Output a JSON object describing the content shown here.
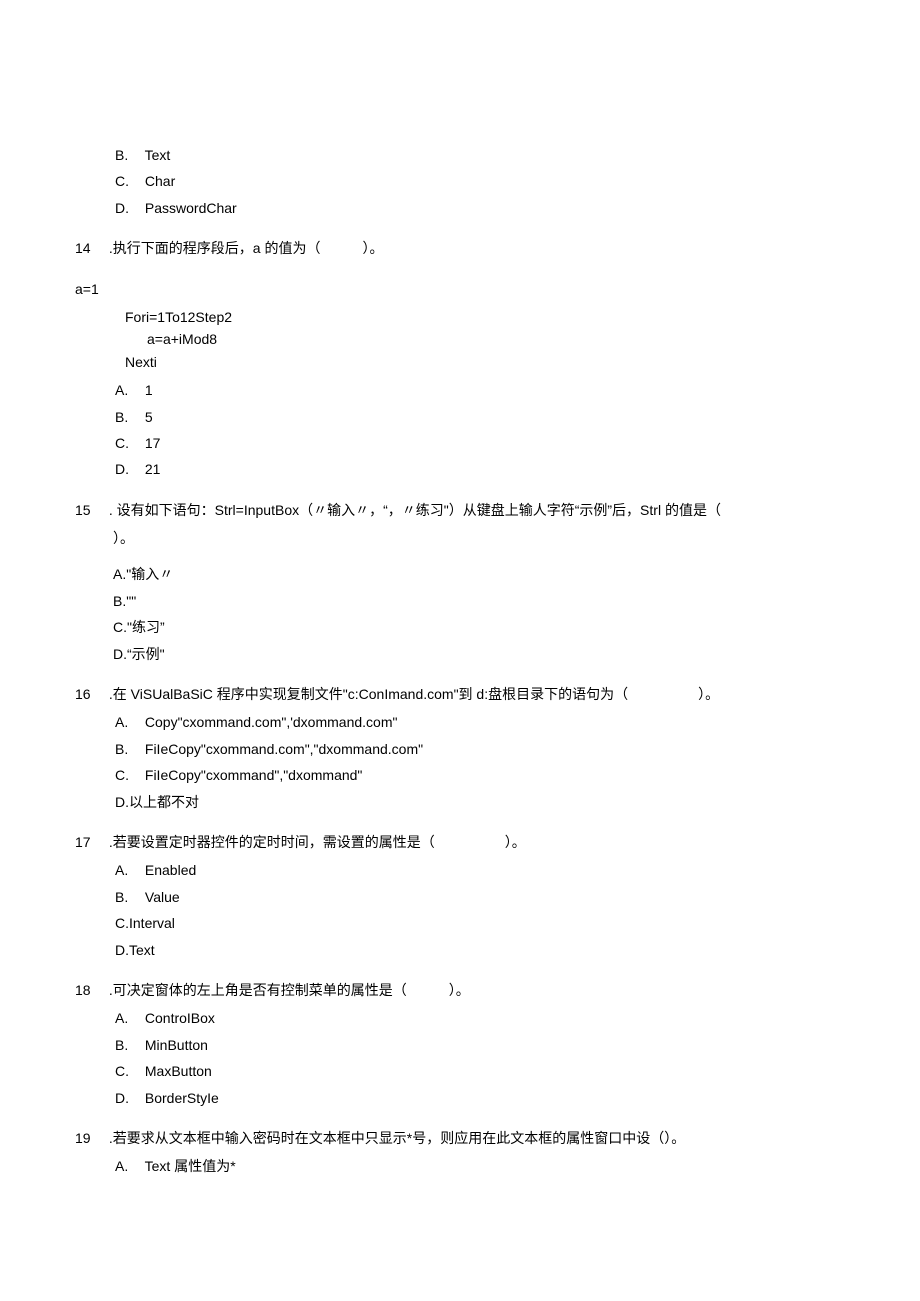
{
  "q13_partial": {
    "optB_letter": "B.",
    "optB_text": "Text",
    "optC_letter": "C.",
    "optC_text": "Char",
    "optD_letter": "D.",
    "optD_text": "PasswordChar"
  },
  "q14": {
    "num": "14",
    "stem": ".执行下面的程序段后，a 的值为（　　　）。",
    "var": "a=1",
    "code1": "Fori=1To12Step2",
    "code2": "a=a+iMod8",
    "code3": "Nexti",
    "optA_letter": "A.",
    "optA_text": "1",
    "optB_letter": "B.",
    "optB_text": "5",
    "optC_letter": "C.",
    "optC_text": "17",
    "optD_letter": "D.",
    "optD_text": "21"
  },
  "q15": {
    "num": "15",
    "stem": ". 设有如下语句：Strl=InputBox（〃输入〃，“，〃练习\"）从键盘上输人字符“示例”后，Strl 的值是（",
    "stem2": "）。",
    "optA": "A.\"输入〃",
    "optB": "B.\"\"",
    "optC": "C.\"练习”",
    "optD": "D.“示例\""
  },
  "q16": {
    "num": "16",
    "stem": ".在 ViSUalBaSiC 程序中实现复制文件\"c:ConImand.com\"到 d:盘根目录下的语句为（　　　　　）。",
    "optA_letter": "A.",
    "optA_text": "Copy\"cxommand.com\",'dxommand.com\"",
    "optB_letter": "B.",
    "optB_text": "FiIeCopy\"cxommand.com\",\"dxommand.com\"",
    "optC_letter": "C.",
    "optC_text": "FiIeCopy\"cxommand\",\"dxommand\"",
    "optD": "D.以上都不对"
  },
  "q17": {
    "num": "17",
    "stem": ".若要设置定时器控件的定时时间，需设置的属性是（　　　　　）。",
    "optA_letter": "A.",
    "optA_text": "Enabled",
    "optB_letter": "B.",
    "optB_text": "Value",
    "optC": "C.Interval",
    "optD": "D.Text"
  },
  "q18": {
    "num": "18",
    "stem": ".可决定窗体的左上角是否有控制菜单的属性是（　　　）。",
    "optA_letter": "A.",
    "optA_text": "ControIBox",
    "optB_letter": "B.",
    "optB_text": "MinButton",
    "optC_letter": "C.",
    "optC_text": "MaxButton",
    "optD_letter": "D.",
    "optD_text": "BorderStyIe"
  },
  "q19": {
    "num": "19",
    "stem": ".若要求从文本框中输入密码时在文本框中只显示*号，则应用在此文本框的属性窗口中设（）。",
    "optA_letter": "A.",
    "optA_text": "Text 属性值为*"
  }
}
